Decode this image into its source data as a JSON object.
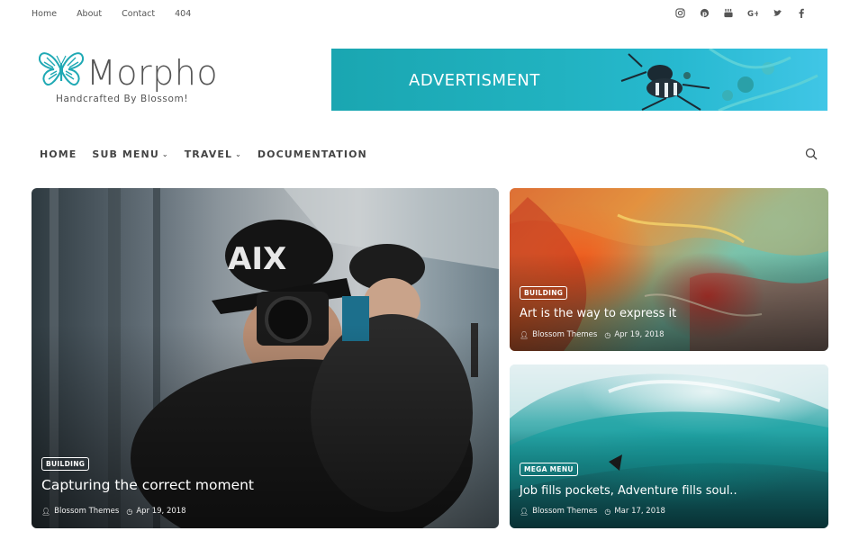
{
  "topnav": [
    "Home",
    "About",
    "Contact",
    "404"
  ],
  "social_icons": [
    "instagram-icon",
    "pinterest-icon",
    "youtube-icon",
    "google-plus-icon",
    "twitter-icon",
    "facebook-icon"
  ],
  "social_glyphs": [
    "◎",
    "℗",
    "▶",
    "G+",
    "🐦",
    "f"
  ],
  "brand": {
    "title": "Morpho",
    "tagline": "Handcrafted By Blossom!",
    "accent": "#1fa9b4"
  },
  "ad": {
    "text": "ADVERTISMENT"
  },
  "mainnav": {
    "home": "HOME",
    "submenu": "SUB MENU",
    "travel": "TRAVEL",
    "docs": "DOCUMENTATION"
  },
  "posts": [
    {
      "category": "BUILDING",
      "title": "Capturing the correct moment",
      "author": "Blossom Themes",
      "date": "Apr 19, 2018"
    },
    {
      "category": "BUILDING",
      "title": "Art is the way to express it",
      "author": "Blossom Themes",
      "date": "Apr 19, 2018"
    },
    {
      "category": "MEGA MENU",
      "title": "Job fills pockets, Adventure fills soul..",
      "author": "Blossom Themes",
      "date": "Mar 17, 2018"
    }
  ]
}
